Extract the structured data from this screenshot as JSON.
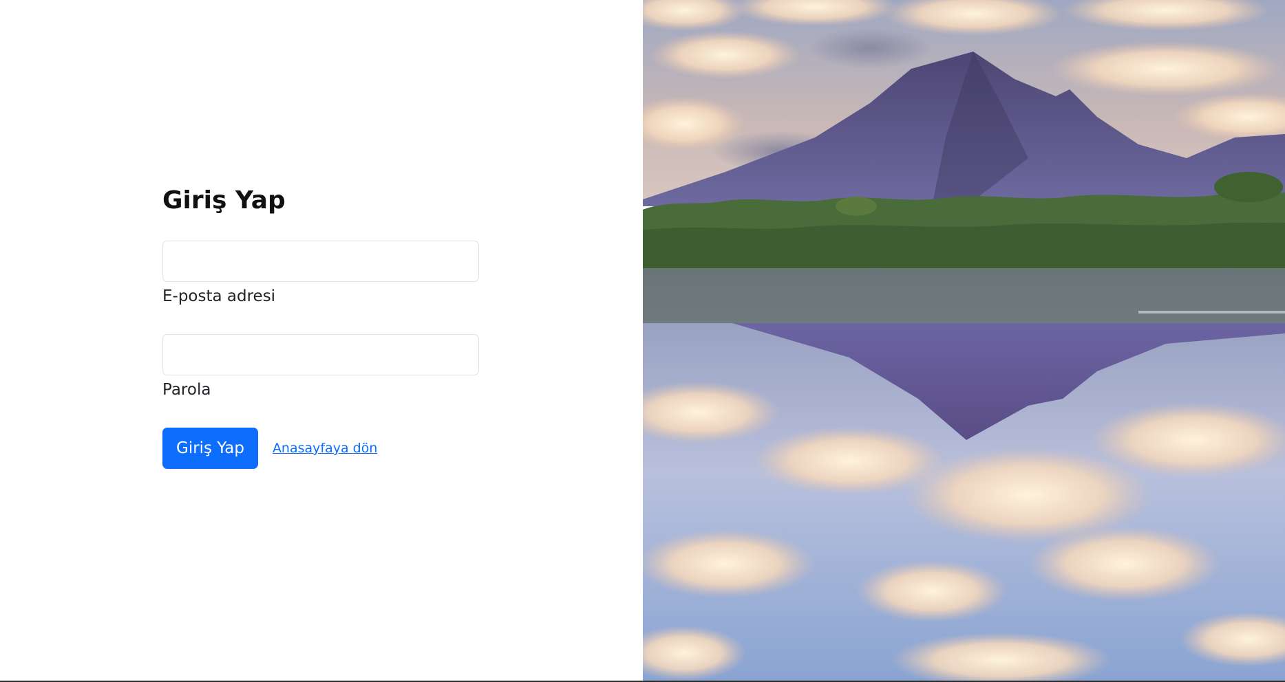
{
  "login": {
    "title": "Giriş Yap",
    "email_label": "E-posta adresi",
    "email_value": "",
    "password_label": "Parola",
    "password_value": "",
    "submit_label": "Giriş Yap",
    "home_link_label": "Anasayfaya dön"
  },
  "colors": {
    "primary": "#0d6efd",
    "input_border": "#dee2e6",
    "text": "#212529"
  }
}
